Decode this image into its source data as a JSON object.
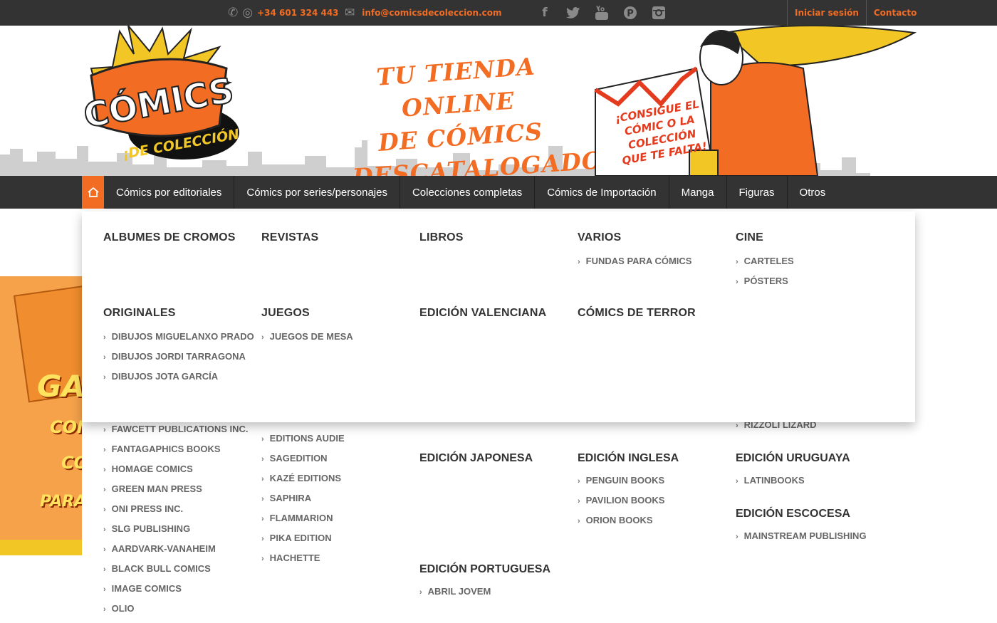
{
  "topbar": {
    "phone": "+34 601 324 443",
    "email": "info@comicsdecoleccion.com",
    "social": [
      "facebook-icon",
      "twitter-icon",
      "youtube-icon",
      "pinterest-icon",
      "instagram-icon"
    ],
    "login": "Iniciar sesión",
    "contact": "Contacto"
  },
  "header": {
    "logo_text": "CÓMICS",
    "logo_sub": "¡DE COLECCIÓN!",
    "tagline_1": "TU TIENDA ONLINE",
    "tagline_2": "DE CÓMICS",
    "tagline_3": "DESCATALOGADOS",
    "sign_text_1": "¡CONSIGUE EL",
    "sign_text_2": "CÓMIC O LA",
    "sign_text_3": "COLECCIÓN",
    "sign_text_4": "QUE TE FALTA!"
  },
  "nav": {
    "items": [
      "Cómics por editoriales",
      "Cómics por series/personajes",
      "Colecciones completas",
      "Cómics de Importación",
      "Manga",
      "Figuras",
      "Otros"
    ]
  },
  "mega": {
    "cols": [
      {
        "title": "ALBUMES DE CROMOS",
        "items": []
      },
      {
        "title": "REVISTAS",
        "items": []
      },
      {
        "title": "LIBROS",
        "items": []
      },
      {
        "title": "VARIOS",
        "items": [
          "FUNDAS PARA CÓMICS"
        ]
      },
      {
        "title": "CINE",
        "items": [
          "CARTELES",
          "PÓSTERS"
        ]
      },
      {
        "title": "ORIGINALES",
        "items": [
          "DIBUJOS MIGUELANXO PRADO",
          "DIBUJOS JORDI TARRAGONA",
          "DIBUJOS JOTA GARCÍA"
        ]
      },
      {
        "title": "JUEGOS",
        "items": [
          "JUEGOS DE MESA"
        ]
      },
      {
        "title": "EDICIÓN VALENCIANA",
        "items": []
      },
      {
        "title": "CÓMICS DE TERROR",
        "items": []
      }
    ]
  },
  "under": {
    "col1": [
      "FAWCETT PUBLICATIONS INC.",
      "FANTAGAPHICS BOOKS",
      "HOMAGE COMICS",
      "GREEN MAN PRESS",
      "ONI PRESS INC.",
      "SLG PUBLISHING",
      "AARDVARK-VANAHEIM",
      "BLACK BULL COMICS",
      "IMAGE COMICS",
      "OLIO"
    ],
    "col2": [
      "EDITIONS AUDIE",
      "SAGEDITION",
      "KAZÉ EDITIONS",
      "SAPHIRA",
      "FLAMMARION",
      "PIKA EDITION",
      "HACHETTE"
    ],
    "japonesa": "EDICIÓN JAPONESA",
    "portuguesa": "EDICIÓN PORTUGUESA",
    "portuguesa_items": [
      "ABRIL JOVEM"
    ],
    "inglesa": "EDICIÓN INGLESA",
    "inglesa_items": [
      "PENGUIN BOOKS",
      "PAVILION BOOKS",
      "ORION BOOKS"
    ],
    "rizzoli": "RIZZOLI LIZARD",
    "uruguaya": "EDICIÓN URUGUAYA",
    "uruguaya_items": [
      "LATINBOOKS"
    ],
    "escocesa": "EDICIÓN ESCOCESA",
    "escocesa_items": [
      "MAINSTREAM PUBLISHING"
    ]
  },
  "promo": {
    "t1": "GA",
    "t2": "CON",
    "t3": "CO",
    "t4": "PARA"
  }
}
